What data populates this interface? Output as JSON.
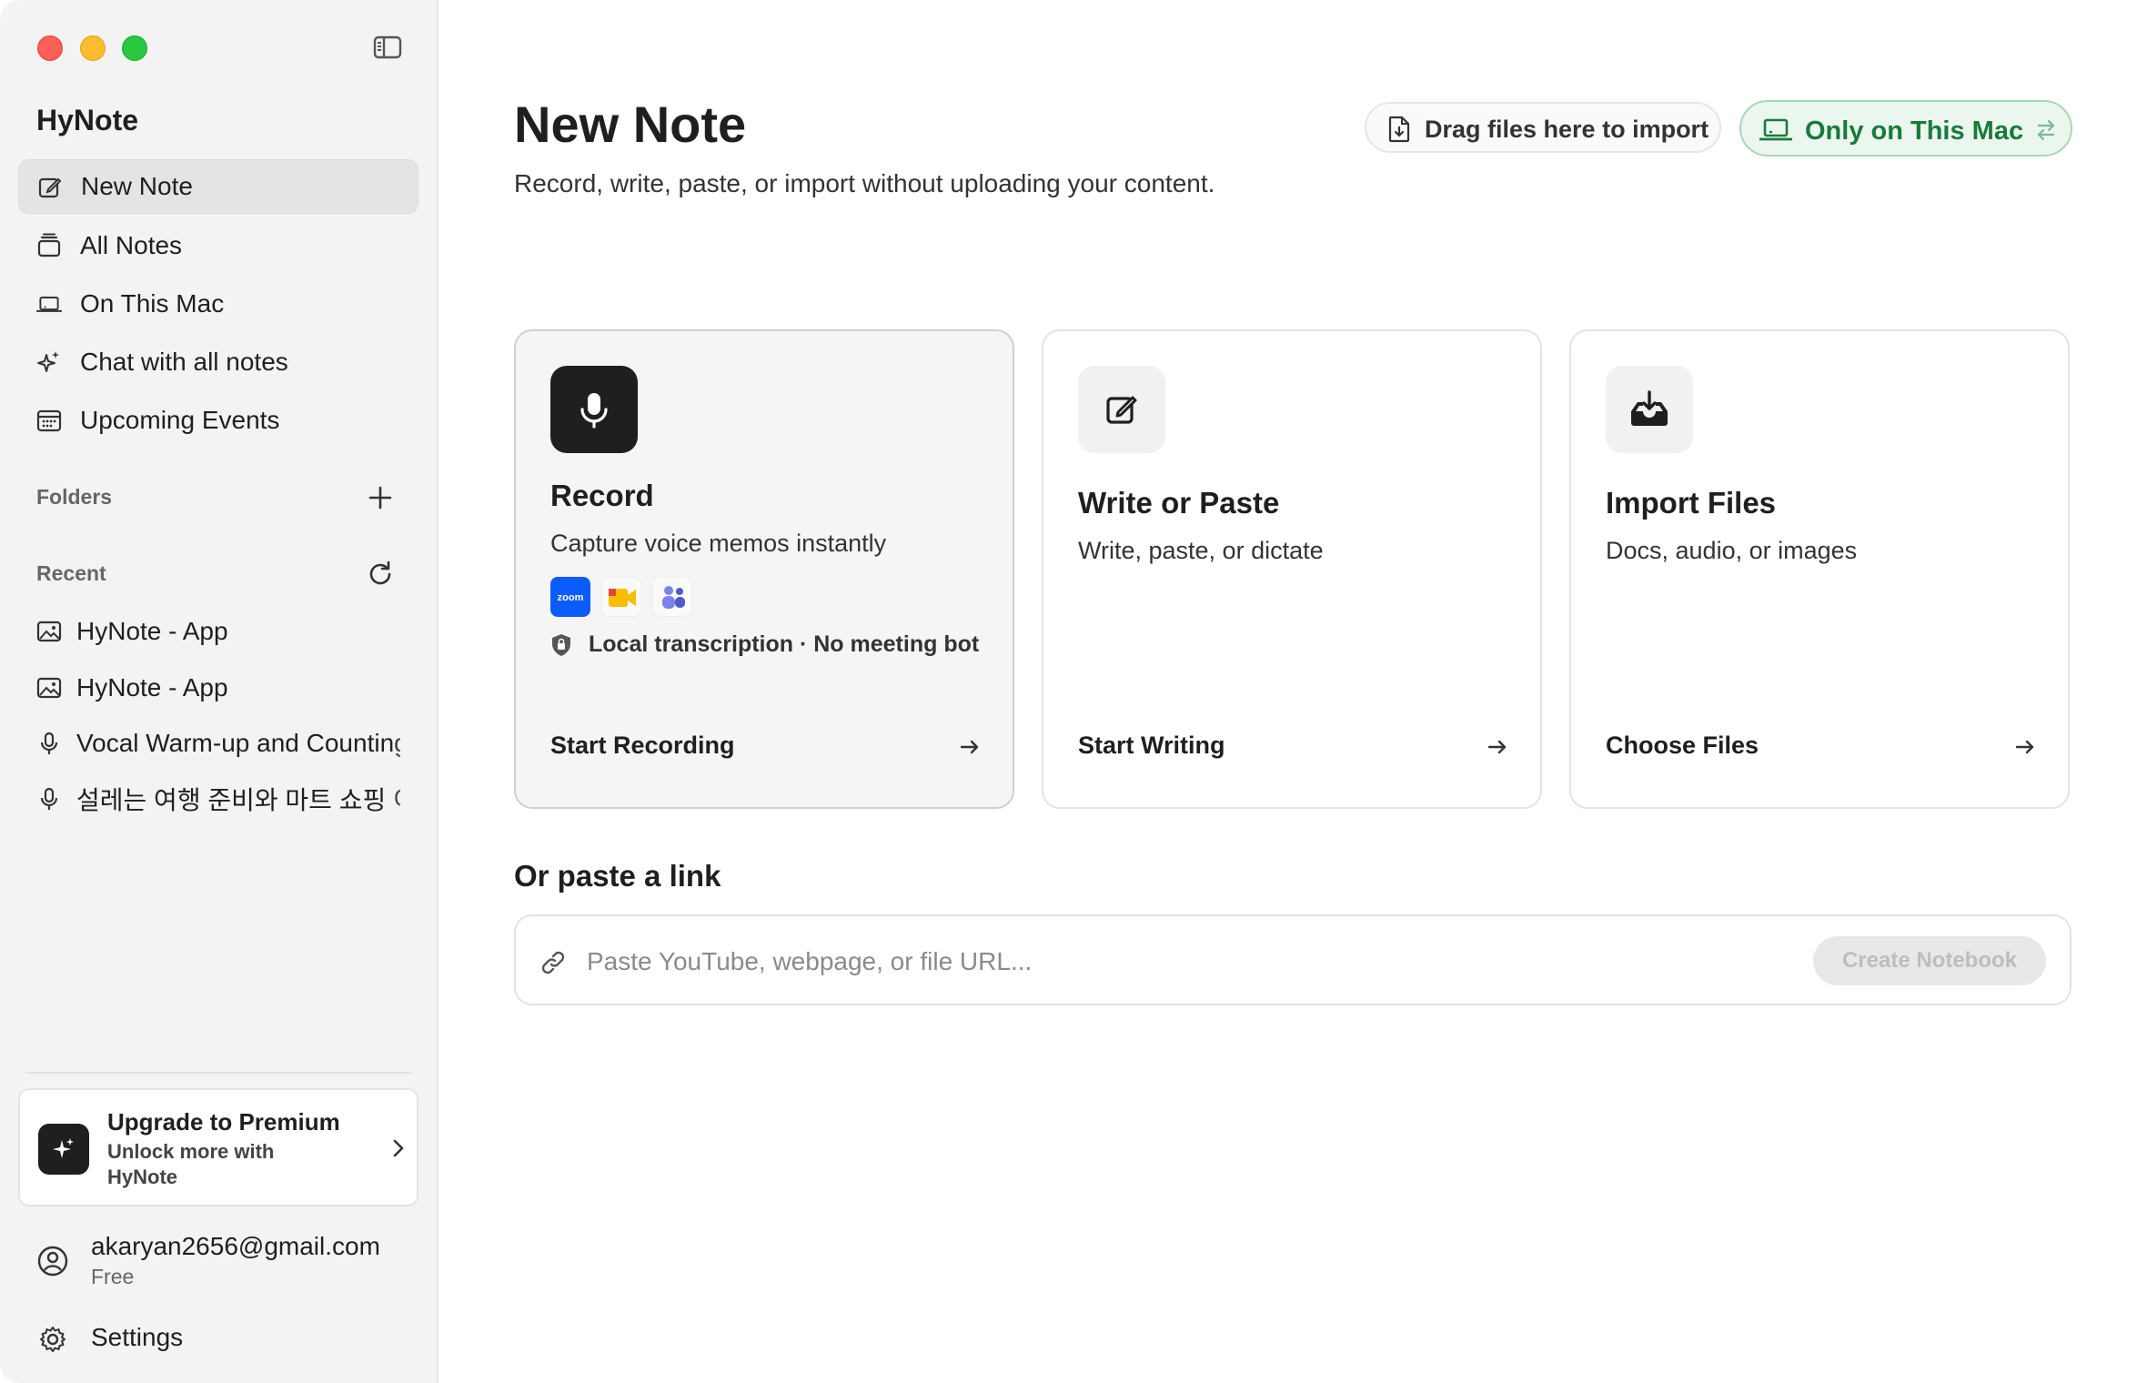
{
  "window": {
    "traffic_lights": [
      "close",
      "minimize",
      "zoom"
    ]
  },
  "sidebar": {
    "app_name": "HyNote",
    "nav": [
      {
        "label": "New Note",
        "icon": "edit-icon",
        "active": true
      },
      {
        "label": "All Notes",
        "icon": "stack-icon"
      },
      {
        "label": "On This Mac",
        "icon": "laptop-icon"
      },
      {
        "label": "Chat with all notes",
        "icon": "sparkle-icon"
      },
      {
        "label": "Upcoming Events",
        "icon": "calendar-icon"
      }
    ],
    "folders_label": "Folders",
    "recent_label": "Recent",
    "recent": [
      {
        "label": "HyNote - App",
        "icon": "image-icon"
      },
      {
        "label": "HyNote - App",
        "icon": "image-icon"
      },
      {
        "label": "Vocal Warm-up and Counting",
        "icon": "mic-icon"
      },
      {
        "label": "설레는 여행 준비와 마트 쇼핑 이야기",
        "icon": "mic-icon"
      }
    ],
    "premium": {
      "title": "Upgrade to Premium",
      "subtitle": "Unlock more with HyNote"
    },
    "account": {
      "email": "akaryan2656@gmail.com",
      "plan": "Free"
    },
    "settings_label": "Settings"
  },
  "main": {
    "title": "New Note",
    "subtitle": "Record, write, paste, or import without uploading your content.",
    "drag_label": "Drag files here to import",
    "storage_label": "Only on This Mac",
    "cards": [
      {
        "title": "Record",
        "desc": "Capture voice memos instantly",
        "badge": "Local transcription · No meeting bot",
        "action": "Start Recording",
        "integrations": [
          "zoom",
          "google-meet",
          "teams"
        ]
      },
      {
        "title": "Write or Paste",
        "desc": "Write, paste, or dictate",
        "action": "Start Writing"
      },
      {
        "title": "Import Files",
        "desc": "Docs, audio, or images",
        "action": "Choose Files"
      }
    ],
    "link_title": "Or paste a link",
    "link_placeholder": "Paste YouTube, webpage, or file URL...",
    "link_button": "Create Notebook",
    "zoom_text": "zoom"
  },
  "colors": {
    "accent_green": "#1a7a3c",
    "sidebar_bg": "#f3f3f3",
    "dark": "#1f1f1f"
  }
}
